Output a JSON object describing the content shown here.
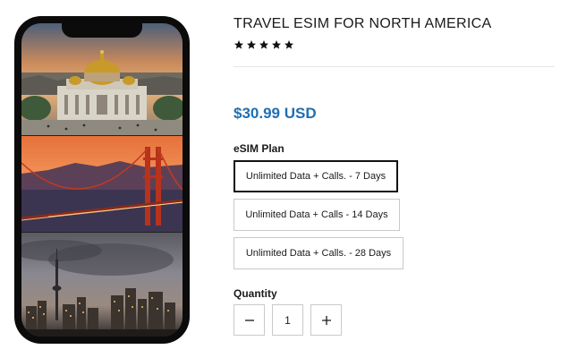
{
  "product": {
    "title": "TRAVEL ESIM FOR NORTH AMERICA",
    "rating_stars": 5,
    "price": "$30.99 USD",
    "price_color": "#1f6fb2"
  },
  "variant": {
    "label": "eSIM Plan",
    "options": [
      {
        "label": "Unlimited Data + Calls. - 7 Days",
        "selected": true
      },
      {
        "label": "Unlimited Data + Calls - 14 Days",
        "selected": false
      },
      {
        "label": "Unlimited Data + Calls. - 28 Days",
        "selected": false
      }
    ]
  },
  "quantity": {
    "label": "Quantity",
    "value": "1",
    "decrement_icon": "minus-icon",
    "increment_icon": "plus-icon"
  },
  "gallery": {
    "images": [
      "mexico-city-palace",
      "golden-gate-bridge-sunset",
      "toronto-skyline"
    ]
  }
}
